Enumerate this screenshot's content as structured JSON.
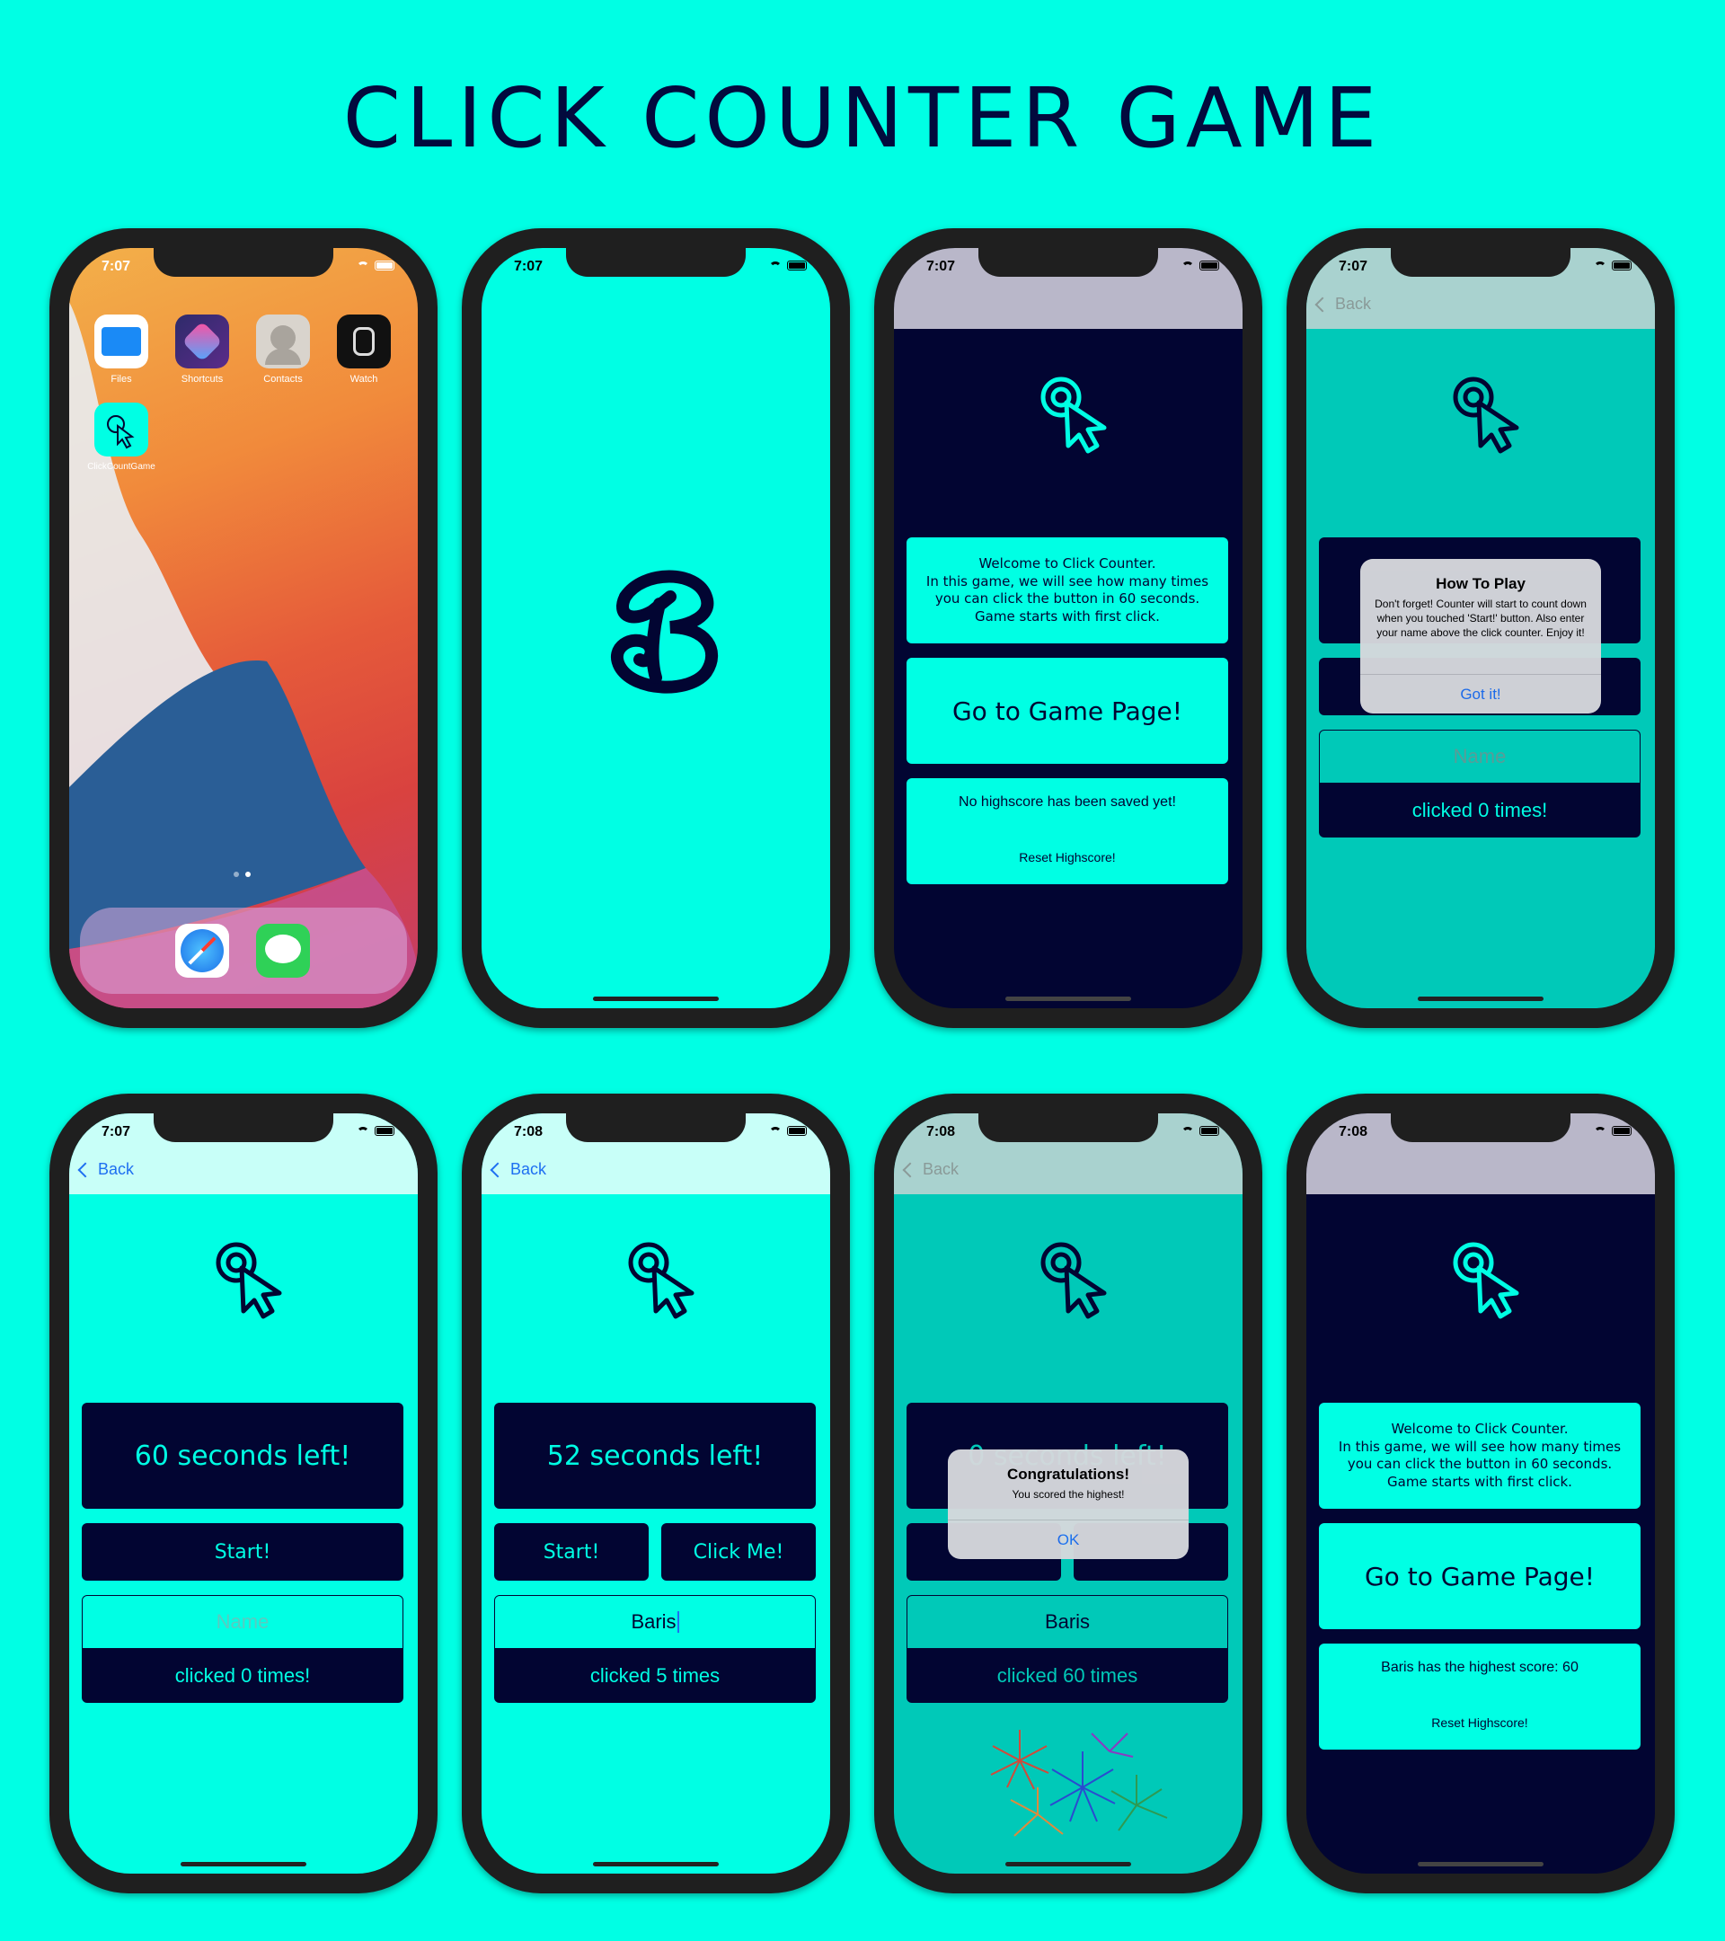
{
  "title": "CLICK COUNTER GAME",
  "colors": {
    "bg": "#00FFE4",
    "navy": "#020532",
    "accent": "#00FFE4",
    "link": "#1e6ff1"
  },
  "common": {
    "back": "Back",
    "name_placeholder": "Name",
    "start": "Start!",
    "click_me": "Click Me!"
  },
  "home": {
    "time": "7:07",
    "apps": [
      "Files",
      "Shortcuts",
      "Contacts",
      "Watch"
    ],
    "game_app": "ClickCountGame",
    "dock": [
      "safari-icon",
      "messages-icon"
    ]
  },
  "splash": {
    "time": "7:07",
    "logo": "app-logo-b"
  },
  "welcome": {
    "time": "7:07",
    "message": "Welcome to Click Counter.\nIn this game, we will see how many times\nyou can click the button in 60 seconds.\nGame starts with first click.",
    "goto": "Go to Game Page!",
    "highscore": "No highscore has been saved yet!",
    "reset": "Reset Highscore!"
  },
  "howto": {
    "time": "7:07",
    "alert_title": "How To Play",
    "alert_message": "Don't forget! Counter will start to count down when you touched 'Start!' button. Also enter your name above the click counter. Enjoy it!",
    "alert_button": "Got it!",
    "name": "Name",
    "count": "clicked 0 times!"
  },
  "game1": {
    "time": "7:07",
    "timer": "60 seconds left!",
    "count": "clicked 0 times!"
  },
  "game2": {
    "time": "7:08",
    "timer": "52 seconds left!",
    "name_value": "Baris",
    "count": "clicked 5 times"
  },
  "game3": {
    "time": "7:08",
    "timer": "0 seconds left!",
    "name_value": "Baris",
    "count": "clicked 60 times",
    "alert_title": "Congratulations!",
    "alert_message": "You scored the highest!",
    "alert_button": "OK"
  },
  "welcome2": {
    "time": "7:08",
    "message": "Welcome to Click Counter.\nIn this game, we will see how many times\nyou can click the button in 60 seconds.\nGame starts with first click.",
    "goto": "Go to Game Page!",
    "highscore": "Baris has the highest score: 60",
    "reset": "Reset Highscore!"
  }
}
